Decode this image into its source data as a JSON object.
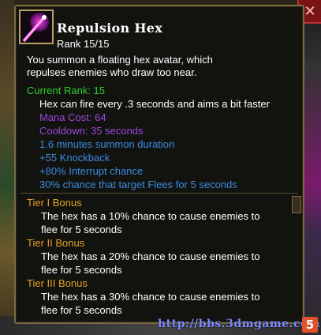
{
  "tooltip": {
    "title": "Repulsion Hex",
    "rank": "Rank 15/15",
    "description_lines": [
      "You summon a floating hex avatar, which",
      "repulses enemies who draw too near."
    ],
    "current_rank_label": "Current Rank: 15",
    "current_effect": "Hex can fire every .3 seconds and aims a bit faster",
    "mana_cost": "Mana Cost: 64",
    "cooldown": "Cooldown: 35 seconds",
    "stats": [
      "1.6 minutes summon duration",
      "+55 Knockback",
      "+80% Interrupt chance",
      "30% chance that target Flees for 5 seconds"
    ],
    "tiers": [
      {
        "label": "Tier I Bonus",
        "lines": [
          "The hex has a 10% chance to cause enemies to",
          "flee for 5 seconds"
        ]
      },
      {
        "label": "Tier II Bonus",
        "lines": [
          "The hex has a 20% chance to cause enemies to",
          "flee for 5 seconds"
        ]
      },
      {
        "label": "Tier III Bonus",
        "lines": [
          "The hex has a 30% chance to cause enemies to",
          "flee for 5 seconds"
        ]
      }
    ]
  },
  "close_glyph": "✕",
  "watermark": {
    "text": "http://bbs.3dmgame.com",
    "logo_glyph": "5"
  },
  "colors": {
    "green_label": "#2ed02e",
    "purple_stat": "#9a49e0",
    "blue_stat": "#3a8ce0",
    "gold_tier": "#e6a226",
    "border": "#7a6a44"
  },
  "icons": [
    "repulsion-hex-skill-icon",
    "close-icon",
    "site-logo-icon"
  ]
}
